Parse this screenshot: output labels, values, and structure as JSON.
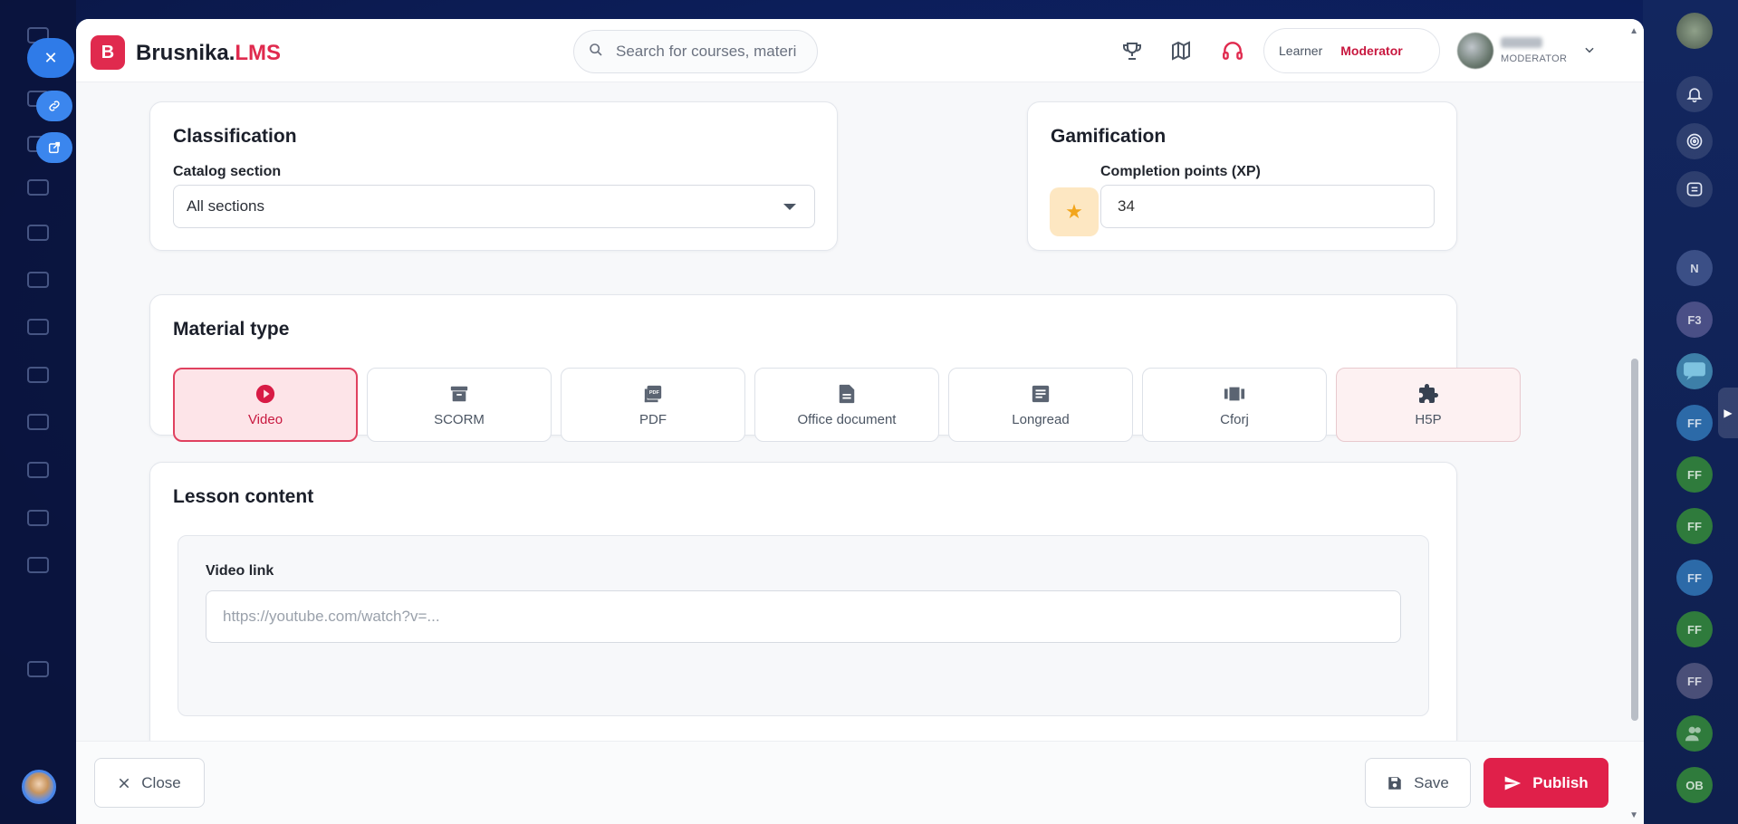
{
  "app": {
    "brand_prefix": "Brusnika.",
    "brand_suffix": "LMS",
    "brand_letter": "B"
  },
  "search": {
    "placeholder": "Search for courses, materi"
  },
  "header": {
    "icons": [
      "trophy-icon",
      "map-icon",
      "headset-icon"
    ],
    "role_learner": "Learner",
    "role_moderator": "Moderator",
    "profile_role": "MODERATOR",
    "active_role": "Moderator"
  },
  "classification": {
    "title": "Classification",
    "catalog_label": "Catalog section",
    "catalog_value": "All sections"
  },
  "gamification": {
    "title": "Gamification",
    "xp_label": "Completion points (XP)",
    "xp_value": "34"
  },
  "material_type": {
    "title": "Material type",
    "selected": "Video",
    "options": [
      {
        "label": "Video",
        "icon": "play-circle-icon"
      },
      {
        "label": "SCORM",
        "icon": "archive-box-icon"
      },
      {
        "label": "PDF",
        "icon": "pdf-icon"
      },
      {
        "label": "Office document",
        "icon": "document-icon"
      },
      {
        "label": "Longread",
        "icon": "article-icon"
      },
      {
        "label": "Cforj",
        "icon": "slides-icon"
      },
      {
        "label": "H5P",
        "icon": "puzzle-icon"
      }
    ]
  },
  "lesson_content": {
    "title": "Lesson content",
    "video_label": "Video link",
    "video_placeholder": "https://youtube.com/watch?v=..."
  },
  "footer": {
    "close_label": "Close",
    "save_label": "Save",
    "publish_label": "Publish"
  },
  "right_rail": {
    "avatars": [
      "N",
      "F3",
      "FF",
      "FF",
      "FF",
      "FF",
      "FF",
      "FF",
      "OB"
    ]
  },
  "colors": {
    "brand": "#e02a4e",
    "publish": "#e0204a",
    "active_tile_bg": "#fde4e8",
    "xp_star": "#f2a51c"
  }
}
